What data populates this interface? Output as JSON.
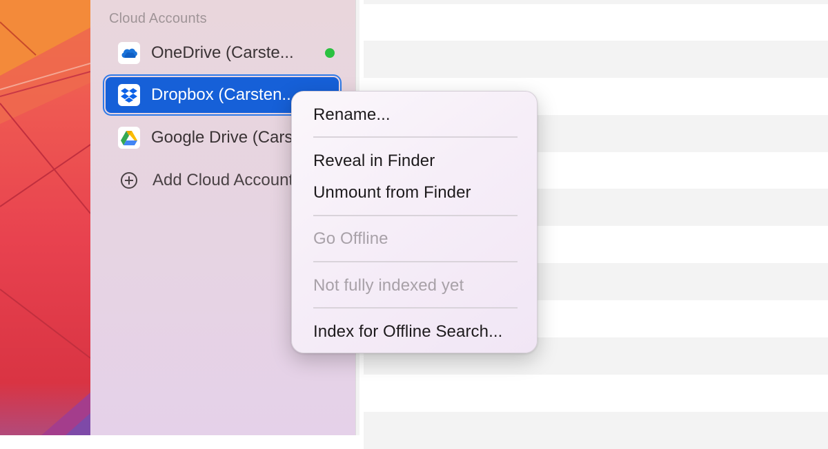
{
  "sidebar": {
    "section_title": "Cloud Accounts",
    "items": [
      {
        "label": "OneDrive (Carste...",
        "icon": "onedrive-icon",
        "status": "online"
      },
      {
        "label": "Dropbox (Carsten...",
        "icon": "dropbox-icon",
        "selected": true
      },
      {
        "label": "Google Drive (Carsten...",
        "icon": "google-drive-icon"
      }
    ],
    "add_account_label": "Add Cloud Account"
  },
  "context_menu": {
    "items": [
      {
        "label": "Rename...",
        "enabled": true
      },
      {
        "label": "Reveal in Finder",
        "enabled": true
      },
      {
        "label": "Unmount from Finder",
        "enabled": true
      },
      {
        "label": "Go Offline",
        "enabled": false
      },
      {
        "label": "Not fully indexed yet",
        "enabled": false
      },
      {
        "label": "Index for Offline Search...",
        "enabled": true
      }
    ]
  },
  "colors": {
    "selection": "#1660d8",
    "status_online": "#2bc140",
    "disabled_text": "#a8a1a8"
  }
}
